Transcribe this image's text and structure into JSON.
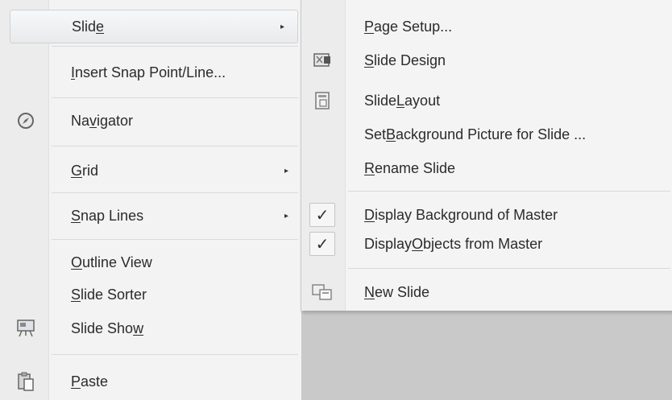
{
  "main_menu": {
    "items": [
      {
        "pre": "Slid",
        "u": "e",
        "post": "",
        "submenu": true
      },
      {
        "pre": "",
        "u": "I",
        "post": "nsert Snap Point/Line...",
        "submenu": false
      },
      {
        "pre": "Na",
        "u": "v",
        "post": "igator",
        "submenu": false,
        "icon": "navigator-icon"
      },
      {
        "pre": "",
        "u": "G",
        "post": "rid",
        "submenu": true
      },
      {
        "pre": "",
        "u": "S",
        "post": "nap Lines",
        "submenu": true
      },
      {
        "pre": "",
        "u": "O",
        "post": "utline View",
        "submenu": false
      },
      {
        "pre": "",
        "u": "S",
        "post": "lide Sorter",
        "submenu": false
      },
      {
        "pre": "Slide Sho",
        "u": "w",
        "post": "",
        "submenu": false,
        "icon": "slide-show-icon"
      },
      {
        "pre": "",
        "u": "P",
        "post": "aste",
        "submenu": false,
        "icon": "paste-icon"
      }
    ],
    "submenu_arrow": "▸"
  },
  "slide_submenu": {
    "items": [
      {
        "pre": "",
        "u": "P",
        "post": "age Setup..."
      },
      {
        "pre": "",
        "u": "S",
        "post": "lide Design",
        "icon": "slide-design-icon"
      },
      {
        "pre": "Slide ",
        "u": "L",
        "post": "ayout",
        "icon": "slide-layout-icon"
      },
      {
        "pre": "Set ",
        "u": "B",
        "post": "ackground Picture for Slide ..."
      },
      {
        "pre": "",
        "u": "R",
        "post": "ename Slide"
      },
      {
        "pre": "",
        "u": "D",
        "post": "isplay Background of Master",
        "checked": true
      },
      {
        "pre": "Display ",
        "u": "O",
        "post": "bjects from Master",
        "checked": true
      },
      {
        "pre": "",
        "u": "N",
        "post": "ew Slide",
        "icon": "new-slide-icon"
      }
    ],
    "check_mark": "✓"
  }
}
